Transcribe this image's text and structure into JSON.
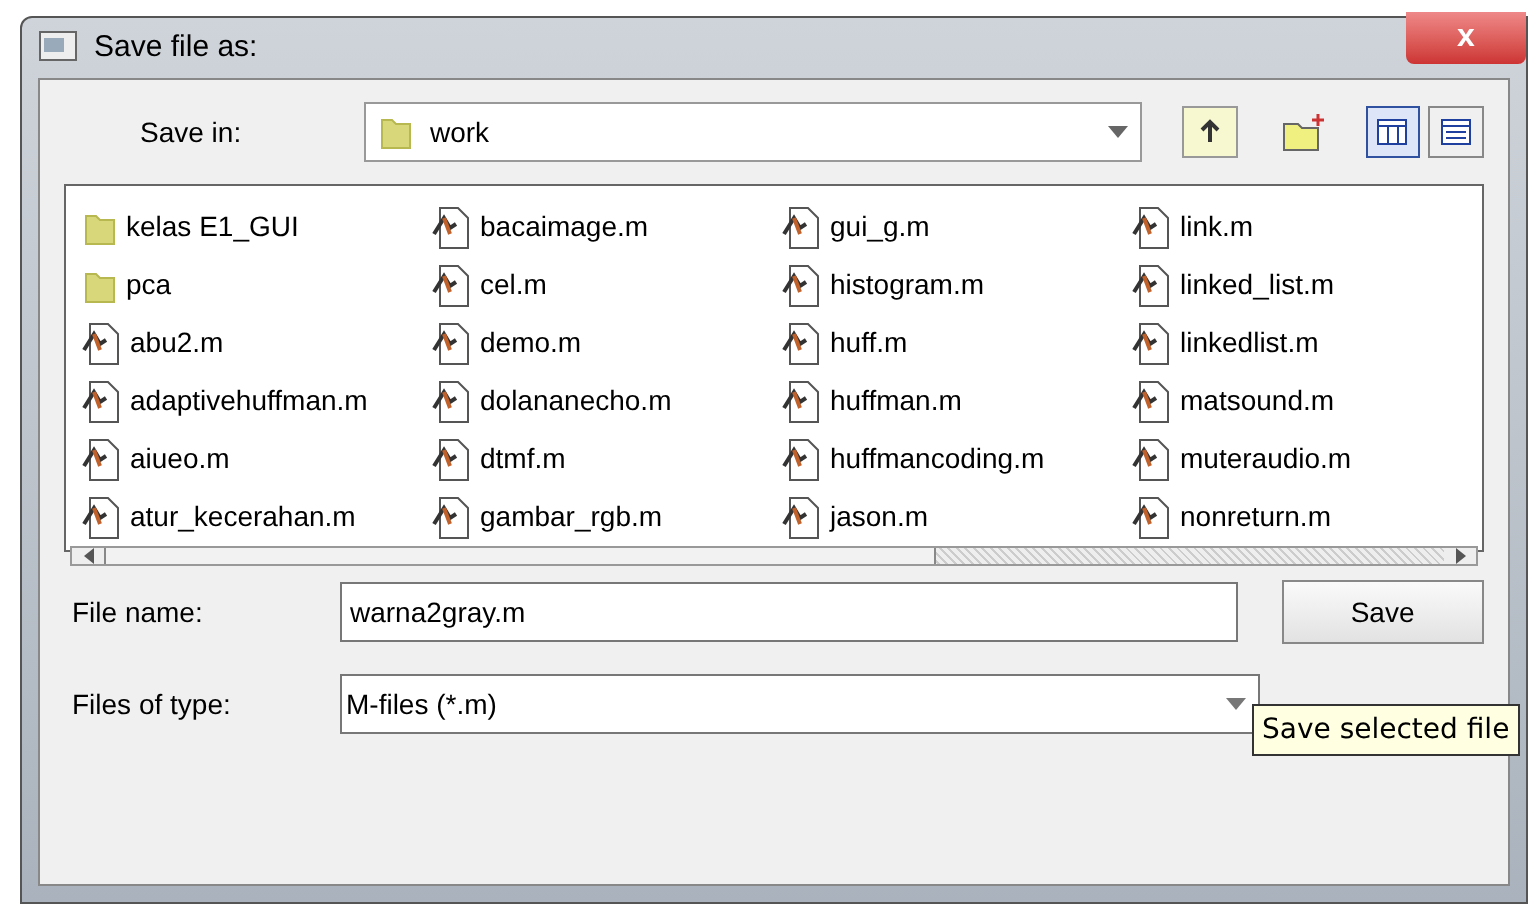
{
  "window": {
    "title": "Save file as:",
    "close": "x"
  },
  "save_in": {
    "label": "Save in:",
    "value": "work"
  },
  "files": [
    {
      "name": "kelas E1_GUI",
      "kind": "folder"
    },
    {
      "name": "pca",
      "kind": "folder"
    },
    {
      "name": "abu2.m",
      "kind": "mfile"
    },
    {
      "name": "adaptivehuffman.m",
      "kind": "mfile"
    },
    {
      "name": "aiueo.m",
      "kind": "mfile"
    },
    {
      "name": "atur_kecerahan.m",
      "kind": "mfile"
    },
    {
      "name": "bacaimage.m",
      "kind": "mfile"
    },
    {
      "name": "cel.m",
      "kind": "mfile"
    },
    {
      "name": "demo.m",
      "kind": "mfile"
    },
    {
      "name": "dolananecho.m",
      "kind": "mfile"
    },
    {
      "name": "dtmf.m",
      "kind": "mfile"
    },
    {
      "name": "gambar_rgb.m",
      "kind": "mfile"
    },
    {
      "name": "gui_g.m",
      "kind": "mfile"
    },
    {
      "name": "histogram.m",
      "kind": "mfile"
    },
    {
      "name": "huff.m",
      "kind": "mfile"
    },
    {
      "name": "huffman.m",
      "kind": "mfile"
    },
    {
      "name": "huffmancoding.m",
      "kind": "mfile"
    },
    {
      "name": "jason.m",
      "kind": "mfile"
    },
    {
      "name": "link.m",
      "kind": "mfile"
    },
    {
      "name": "linked_list.m",
      "kind": "mfile"
    },
    {
      "name": "linkedlist.m",
      "kind": "mfile"
    },
    {
      "name": "matsound.m",
      "kind": "mfile"
    },
    {
      "name": "muteraudio.m",
      "kind": "mfile"
    },
    {
      "name": "nonreturn.m",
      "kind": "mfile"
    }
  ],
  "file_name": {
    "label": "File name:",
    "value": "warna2gray.m"
  },
  "files_of_type": {
    "label": "Files of type:",
    "value": "M-files (*.m)"
  },
  "buttons": [
    {
      "label": "Save"
    }
  ],
  "tooltip": "Save selected file"
}
